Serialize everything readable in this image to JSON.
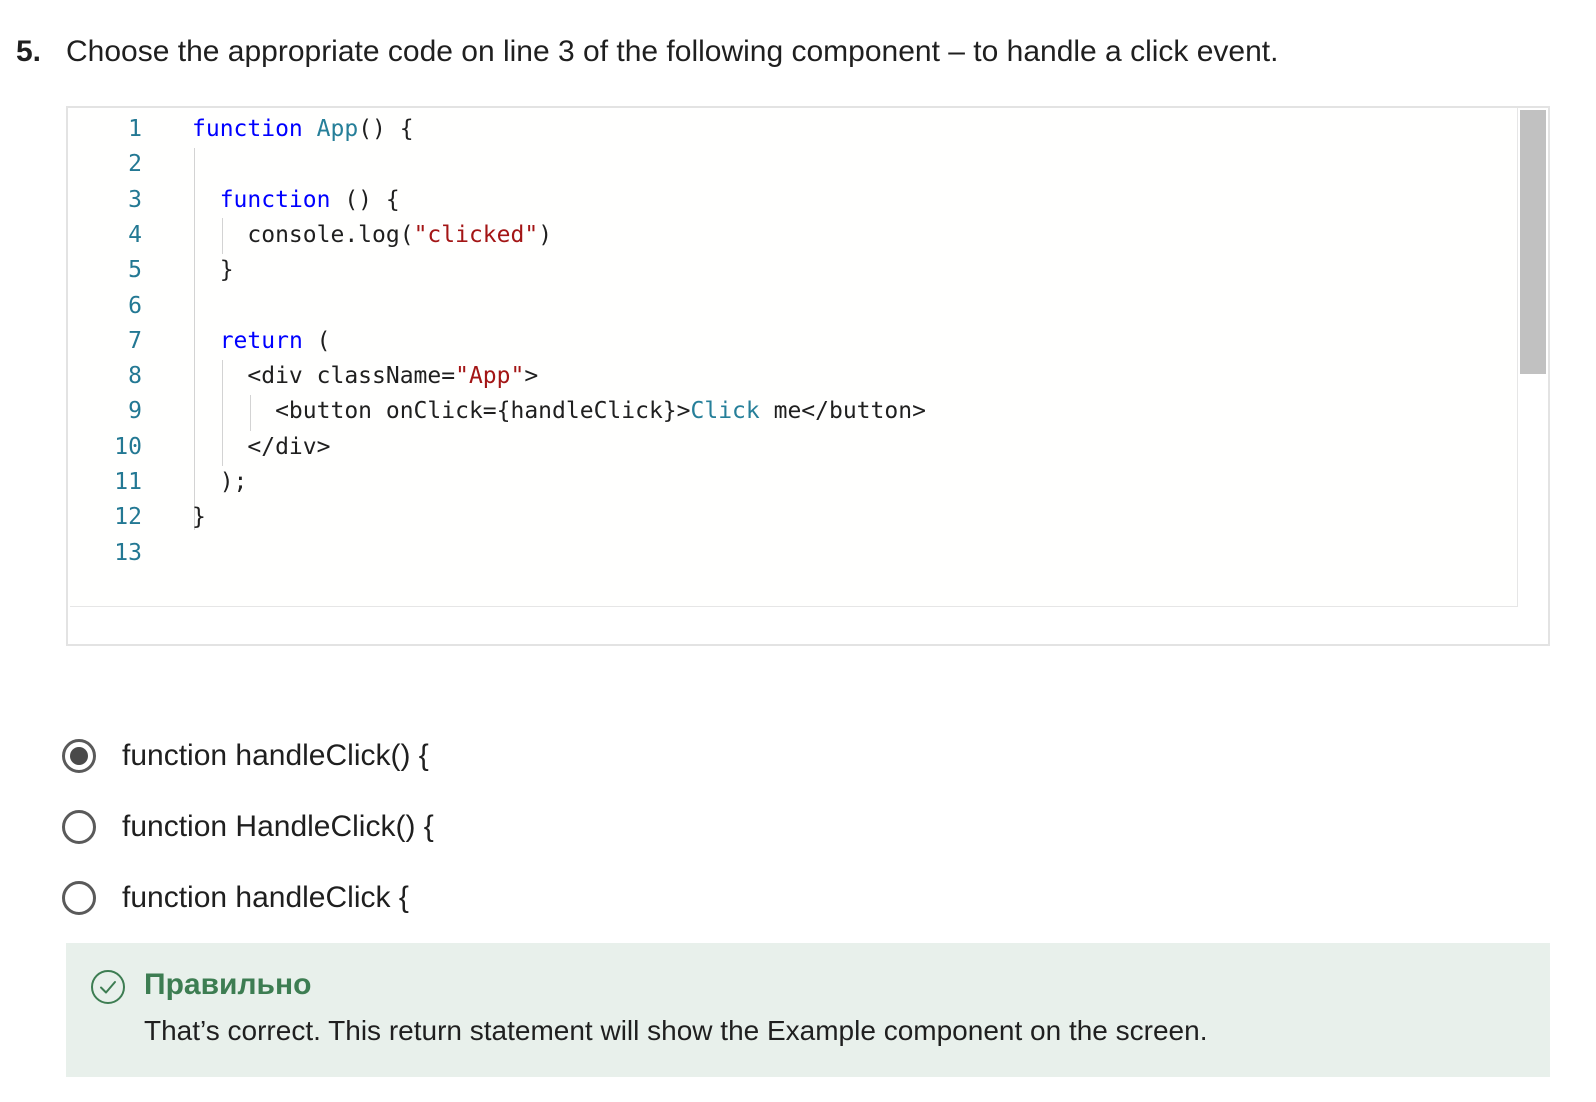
{
  "question": {
    "number": "5.",
    "text": "Choose the appropriate code on line 3 of the following component – to handle a click event."
  },
  "code": {
    "line_numbers": [
      "1",
      "2",
      "3",
      "4",
      "5",
      "6",
      "7",
      "8",
      "9",
      "10",
      "11",
      "12",
      "13"
    ],
    "lines": [
      [
        {
          "t": "function",
          "c": "kw"
        },
        {
          "t": " "
        },
        {
          "t": "App",
          "c": "fn"
        },
        {
          "t": "() {"
        }
      ],
      [],
      [
        {
          "t": "  "
        },
        {
          "t": "function",
          "c": "kw"
        },
        {
          "t": " () {"
        }
      ],
      [
        {
          "t": "    console.log("
        },
        {
          "t": "\"clicked\"",
          "c": "str"
        },
        {
          "t": ")"
        }
      ],
      [
        {
          "t": "  }"
        }
      ],
      [],
      [
        {
          "t": "  "
        },
        {
          "t": "return",
          "c": "kw"
        },
        {
          "t": " ("
        }
      ],
      [
        {
          "t": "    <div className="
        },
        {
          "t": "\"App\"",
          "c": "str"
        },
        {
          "t": ">"
        }
      ],
      [
        {
          "t": "      <button onClick={handleClick}>"
        },
        {
          "t": "Click",
          "c": "jsx"
        },
        {
          "t": " me</button>"
        }
      ],
      [
        {
          "t": "    </div>"
        }
      ],
      [
        {
          "t": "  );"
        }
      ],
      [
        {
          "t": "}"
        }
      ],
      []
    ]
  },
  "options": [
    {
      "label": "function handleClick() {",
      "selected": true
    },
    {
      "label": "function HandleClick() {",
      "selected": false
    },
    {
      "label": "function handleClick {",
      "selected": false
    }
  ],
  "feedback": {
    "title": "Правильно",
    "text": "That’s correct. This return statement will show the Example component on the screen.",
    "icon": "check-circle-icon",
    "color": "#3d7d52"
  }
}
